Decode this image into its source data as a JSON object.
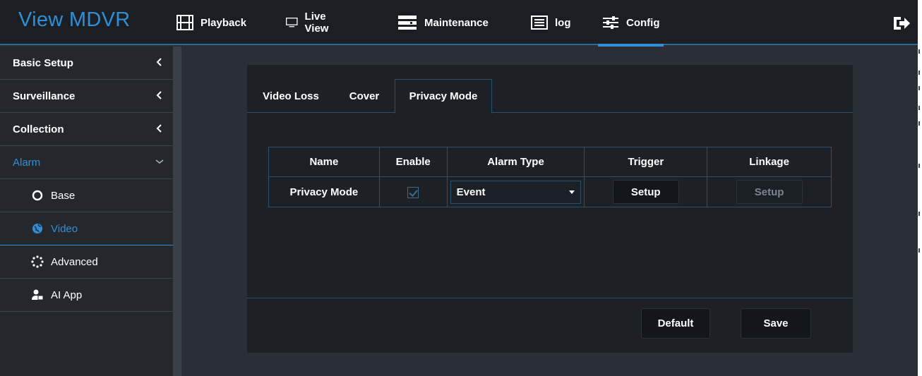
{
  "app": {
    "title": "View MDVR"
  },
  "nav": [
    {
      "label": "Playback",
      "icon": "film-icon"
    },
    {
      "label": "Live View",
      "icon": "monitor-icon"
    },
    {
      "label": "Maintenance",
      "icon": "server-icon"
    },
    {
      "label": "log",
      "icon": "list-icon"
    },
    {
      "label": "Config",
      "icon": "sliders-icon",
      "active": true
    }
  ],
  "sidebar": {
    "groups": [
      {
        "label": "Basic Setup"
      },
      {
        "label": "Surveillance"
      },
      {
        "label": "Collection"
      },
      {
        "label": "Alarm",
        "open": true
      }
    ],
    "items": [
      {
        "label": "Base",
        "icon": "circle-icon"
      },
      {
        "label": "Video",
        "icon": "globe-icon",
        "active": true
      },
      {
        "label": "Advanced",
        "icon": "dots-circle-icon"
      },
      {
        "label": "AI App",
        "icon": "users-icon"
      }
    ]
  },
  "tabs": [
    {
      "label": "Video Loss"
    },
    {
      "label": "Cover"
    },
    {
      "label": "Privacy Mode",
      "active": true
    }
  ],
  "table": {
    "headers": [
      "Name",
      "Enable",
      "Alarm Type",
      "Trigger",
      "Linkage"
    ],
    "rows": [
      {
        "name": "Privacy Mode",
        "enabled": true,
        "alarm_type": "Event",
        "trigger": "Setup",
        "linkage": "Setup"
      }
    ]
  },
  "buttons": {
    "default": "Default",
    "save": "Save"
  },
  "colors": {
    "accent": "#2f8fd6",
    "background": "#2a2f35",
    "topbar": "#1b1f24",
    "panel": "#1d2126"
  }
}
